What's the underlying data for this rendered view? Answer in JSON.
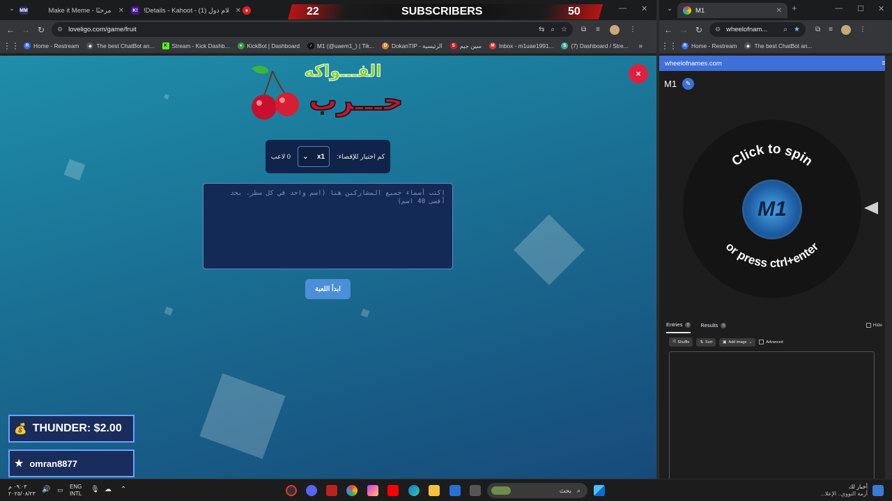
{
  "left_window": {
    "tabs": [
      {
        "label": "Make it Meme - مرحبًا",
        "fav": "MM",
        "fav_color": "#2d2d6e"
      },
      {
        "label": "!Details - Kahoot - أعلام دول (1)",
        "fav": "K!",
        "fav_color": "#46178f"
      },
      {
        "label": "",
        "fav": "●",
        "fav_color": "#e02020"
      }
    ],
    "url": "loveligo.com/game/fruit",
    "bookmarks": [
      {
        "label": "Home - Restream",
        "icon": "R",
        "color": "#3b6ee8"
      },
      {
        "label": "The best ChatBot an...",
        "icon": "◆",
        "color": "#555"
      },
      {
        "label": "Stream - Kick Dashb...",
        "icon": "K",
        "color": "#53fc18"
      },
      {
        "label": "KickBot | Dashboard",
        "icon": "●",
        "color": "#2ea043"
      },
      {
        "label": "M1 (@uaem1_) | Tik...",
        "icon": "♪",
        "color": "#111"
      },
      {
        "label": "DokanTIP - الرئيسية",
        "icon": "D",
        "color": "#c9822b"
      },
      {
        "label": "سين جيم",
        "icon": "S",
        "color": "#c22"
      },
      {
        "label": "Inbox - m1uae1991...",
        "icon": "M",
        "color": "#d33"
      },
      {
        "label": "(7) Dashboard / Stre...",
        "icon": "S",
        "color": "#4a9"
      }
    ],
    "game": {
      "logo_line1": "الفـــواكه",
      "logo_line2": "حـــرب",
      "select_label": "كم اختيار للإقصاء:",
      "select_value": "x1",
      "players_count": "0 لاعب",
      "names_placeholder": "اكتب أسماء جميع المشاركين هنا (اسم واحد في كل سطر، بحد أقصى 40 اسم)",
      "start_label": "ابدأ اللعبة",
      "close_label": "×"
    },
    "overlay": {
      "left_num": "22",
      "center": "SUBSCRIBERS",
      "right_num": "50"
    },
    "badges": [
      {
        "icon": "money-bag-icon",
        "glyph": "💰",
        "text": "THUNDER: $2.00"
      },
      {
        "icon": "star-icon",
        "glyph": "★",
        "text": "omran8877"
      }
    ]
  },
  "right_window": {
    "tab_label": "M1",
    "url": "wheelofnam...",
    "bookmarks": [
      {
        "label": "Home - Restream",
        "icon": "R",
        "color": "#3b6ee8"
      },
      {
        "label": "The best ChatBot an...",
        "icon": "◆",
        "color": "#555"
      }
    ],
    "site_title": "wheelofnames.com",
    "wheel_title": "M1",
    "spin_top": "Click to spin",
    "spin_bottom": "or press ctrl+enter",
    "hub_text": "M1",
    "entries_tab": "Entries",
    "results_tab": "Results",
    "entries_count": "0",
    "results_count": "0",
    "hide_label": "Hide",
    "tools": [
      "Shuffle",
      "Sort",
      "Add image",
      "Advanced"
    ]
  },
  "taskbar": {
    "time": "٠٩:٠٣ م",
    "date": "٢٠٢٥/٠٨/٢٣",
    "lang1": "ENG",
    "lang2": "INTL",
    "search_text": "بحث",
    "news_title": "أخبار لك",
    "news_sub": "أزمة النووي.. الإعلا..."
  }
}
